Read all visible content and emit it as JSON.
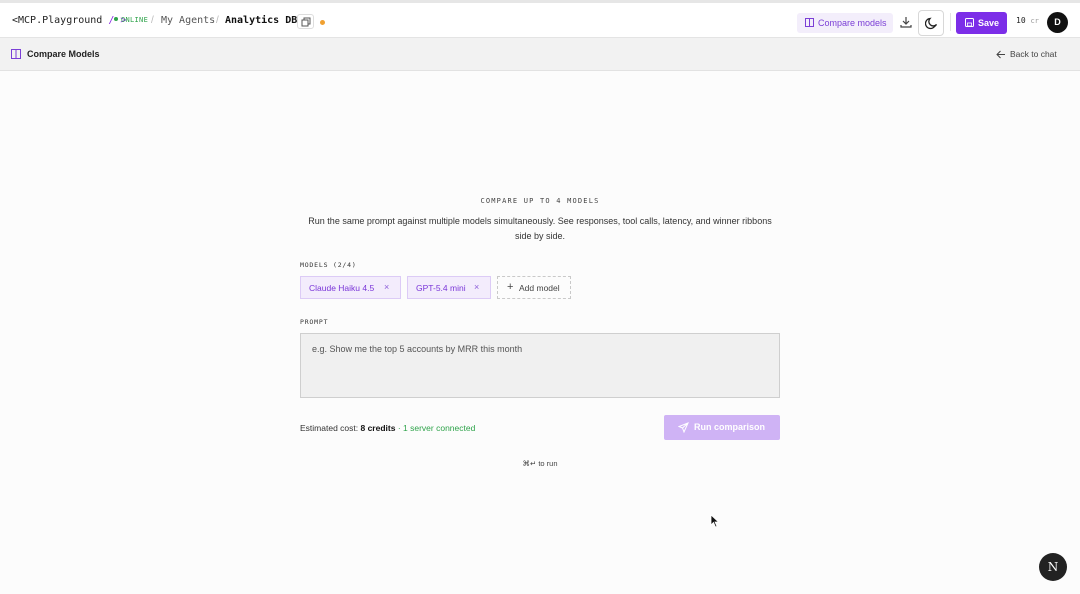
{
  "app": {
    "brand_prefix": "<MCP",
    "brand_name": ".Playground",
    "brand_suffix": "/ >",
    "status": "ONLINE",
    "breadcrumb_agents": "My Agents",
    "breadcrumb_current": "Analytics DB"
  },
  "toolbar": {
    "compare_label": "Compare models",
    "save_label": "Save",
    "credits_value": "10",
    "credits_unit": "cr",
    "avatar_initial": "D"
  },
  "subheader": {
    "title": "Compare Models",
    "back_label": "Back to chat"
  },
  "main": {
    "kicker": "COMPARE UP TO 4 MODELS",
    "description": "Run the same prompt against multiple models simultaneously. See responses, tool calls, latency, and winner ribbons side by side.",
    "models_label": "MODELS (2/4)",
    "models": [
      {
        "name": "Claude Haiku 4.5"
      },
      {
        "name": "GPT-5.4 mini"
      }
    ],
    "add_model_label": "Add model",
    "prompt_label": "PROMPT",
    "prompt_placeholder": "e.g. Show me the top 5 accounts by MRR this month",
    "cost_prefix": "Estimated cost:",
    "cost_value": "8 credits",
    "server_status": "· 1 server connected",
    "run_label": "Run comparison",
    "shortcut_hint": "⌘↵ to run"
  },
  "colors": {
    "accent": "#7c2ee8",
    "accent_light": "#cfb3f5",
    "online": "#2ea34a",
    "unsaved": "#f0a030"
  },
  "badge_letter": "N"
}
